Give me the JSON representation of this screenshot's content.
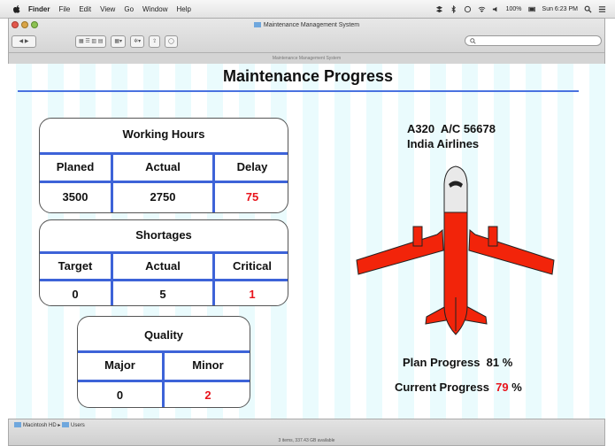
{
  "menubar": {
    "items": [
      "Finder",
      "File",
      "Edit",
      "View",
      "Go",
      "Window",
      "Help"
    ],
    "battery": "100%",
    "clock": "Sun 6:23 PM"
  },
  "window": {
    "title": "Maintenance Management System",
    "path_title": "Maintenance Management System",
    "breadcrumb": [
      "Macintosh HD",
      "Users"
    ],
    "status": "3 items, 337.43 GB available"
  },
  "page": {
    "heading": "Maintenance Progress"
  },
  "working_hours": {
    "title": "Working Hours",
    "headers": [
      "Planed",
      "Actual",
      "Delay"
    ],
    "values": [
      "3500",
      "2750",
      "75"
    ]
  },
  "shortages": {
    "title": "Shortages",
    "headers": [
      "Target",
      "Actual",
      "Critical"
    ],
    "values": [
      "0",
      "5",
      "1"
    ]
  },
  "quality": {
    "title": "Quality",
    "headers": [
      "Major",
      "Minor"
    ],
    "values": [
      "0",
      "2"
    ]
  },
  "aircraft": {
    "model_line": "A320  A/C 56678",
    "airline": "India Airlines",
    "plan_label": "Plan Progress",
    "plan_value": "81",
    "current_label": "Current Progress",
    "current_value": "79",
    "unit": "%",
    "colors": {
      "body": "#f2240a",
      "nose": "#e9e9e9",
      "accent": "#e8141c",
      "rule": "#4a72e0"
    }
  }
}
